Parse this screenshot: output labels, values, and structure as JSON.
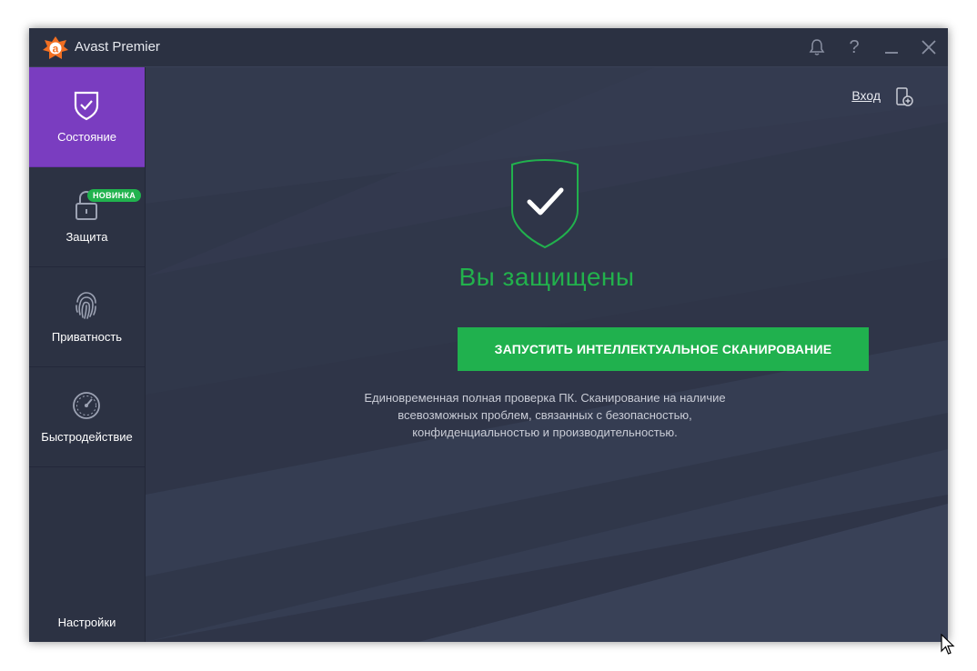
{
  "window": {
    "title": "Avast Premier"
  },
  "titlebar_icons": [
    "bell-icon",
    "help-icon",
    "minimize-icon",
    "close-icon"
  ],
  "titlebar_labels": {
    "help": "?"
  },
  "sidebar": {
    "items": [
      {
        "label": "Состояние",
        "icon": "shield-check-icon",
        "active": true
      },
      {
        "label": "Защита",
        "icon": "lock-icon",
        "badge": "НОВИНКА"
      },
      {
        "label": "Приватность",
        "icon": "fingerprint-icon"
      },
      {
        "label": "Быстродействие",
        "icon": "speedometer-icon"
      }
    ],
    "settings_label": "Настройки"
  },
  "header": {
    "login_label": "Вход",
    "add_device_icon": "add-device-icon"
  },
  "main": {
    "status": "Вы защищены",
    "scan_button": "ЗАПУСТИТЬ ИНТЕЛЛЕКТУАЛЬНОЕ СКАНИРОВАНИЕ",
    "description_lines": [
      "Единовременная полная проверка ПК. Сканирование на наличие",
      "всевозможных проблем, связанных с безопасностью,",
      "конфиденциальностью и производительностью."
    ]
  },
  "colors": {
    "accent_green": "#20b14e",
    "active_purple": "#7a3dc0",
    "logo_orange": "#f26f21",
    "background": "#2f3548"
  }
}
